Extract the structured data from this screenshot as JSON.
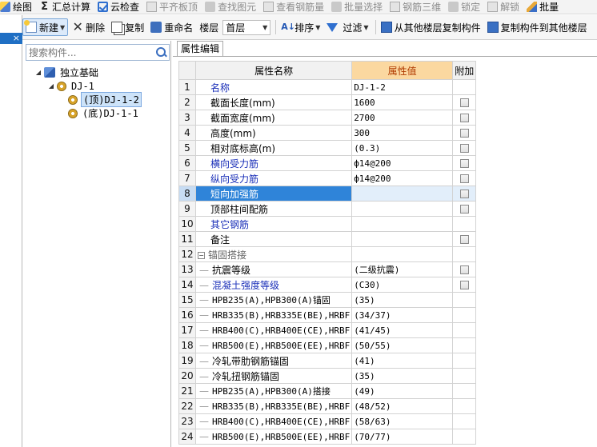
{
  "toolbar1": {
    "items": [
      {
        "label": "绘图",
        "icon": "draw-icon",
        "disabled": false
      },
      {
        "label": "汇总计算",
        "icon": "sum-icon",
        "disabled": false
      },
      {
        "label": "云检查",
        "icon": "cloud-check-icon",
        "disabled": false
      },
      {
        "label": "平齐板顶",
        "icon": "align-top-icon",
        "disabled": true
      },
      {
        "label": "查找图元",
        "icon": "find-element-icon",
        "disabled": true
      },
      {
        "label": "查看钢筋量",
        "icon": "view-rebar-icon",
        "disabled": true
      },
      {
        "label": "批量选择",
        "icon": "batch-select-icon",
        "disabled": true
      },
      {
        "label": "钢筋三维",
        "icon": "rebar-3d-icon",
        "disabled": true
      },
      {
        "label": "锁定",
        "icon": "lock-icon",
        "disabled": true
      },
      {
        "label": "解锁",
        "icon": "unlock-icon",
        "disabled": true
      },
      {
        "label": "批量",
        "icon": "batch-icon",
        "disabled": false
      }
    ]
  },
  "toolbar2": {
    "new_label": "新建",
    "delete_label": "删除",
    "copy_label": "复制",
    "rename_label": "重命名",
    "floor_label": "楼层",
    "floor_value": "首层",
    "sort_label": "排序",
    "filter_label": "过滤",
    "copy_from_label": "从其他楼层复制构件",
    "copy_to_label": "复制构件到其他楼层"
  },
  "left_strip": {
    "tab_close": "×"
  },
  "tree": {
    "search_placeholder": "搜索构件...",
    "root": "独立基础",
    "group": "DJ-1",
    "children": [
      "(顶)DJ-1-2",
      "(底)DJ-1-1"
    ]
  },
  "props": {
    "tab": "属性编辑",
    "headers": {
      "name": "属性名称",
      "value": "属性值",
      "extra": "附加"
    },
    "rows": [
      {
        "n": "1",
        "name": "名称",
        "value": "DJ-1-2",
        "style": "blue",
        "cb": false
      },
      {
        "n": "2",
        "name": "截面长度(mm)",
        "value": "1600",
        "style": "",
        "cb": true
      },
      {
        "n": "3",
        "name": "截面宽度(mm)",
        "value": "2700",
        "style": "",
        "cb": true
      },
      {
        "n": "4",
        "name": "高度(mm)",
        "value": "300",
        "style": "",
        "cb": true
      },
      {
        "n": "5",
        "name": "相对底标高(m)",
        "value": "(0.3)",
        "style": "",
        "cb": true
      },
      {
        "n": "6",
        "name": "横向受力筋",
        "value": "ф14@200",
        "style": "blue",
        "cb": true
      },
      {
        "n": "7",
        "name": "纵向受力筋",
        "value": "ф14@200",
        "style": "blue",
        "cb": true
      },
      {
        "n": "8",
        "name": "短向加强筋",
        "value": "",
        "style": "blue",
        "cb": true,
        "selected": true
      },
      {
        "n": "9",
        "name": "顶部柱间配筋",
        "value": "",
        "style": "",
        "cb": true
      },
      {
        "n": "10",
        "name": "其它钢筋",
        "value": "",
        "style": "blue",
        "cb": false
      },
      {
        "n": "11",
        "name": "备注",
        "value": "",
        "style": "",
        "cb": true
      },
      {
        "n": "12",
        "name": "锚固搭接",
        "value": "",
        "style": "grey",
        "cb": false,
        "group": true
      },
      {
        "n": "13",
        "name": "抗震等级",
        "value": "(二级抗震)",
        "style": "sub",
        "cb": true
      },
      {
        "n": "14",
        "name": "混凝土强度等级",
        "value": "(C30)",
        "style": "sub blue",
        "cb": true
      },
      {
        "n": "15",
        "name": "HPB235(A),HPB300(A)锚固",
        "value": "(35)",
        "style": "sub",
        "cb": false
      },
      {
        "n": "16",
        "name": "HRB335(B),HRB335E(BE),HRBF",
        "value": "(34/37)",
        "style": "sub",
        "cb": false
      },
      {
        "n": "17",
        "name": "HRB400(C),HRB400E(CE),HRBF",
        "value": "(41/45)",
        "style": "sub",
        "cb": false
      },
      {
        "n": "18",
        "name": "HRB500(E),HRB500E(EE),HRBF",
        "value": "(50/55)",
        "style": "sub",
        "cb": false
      },
      {
        "n": "19",
        "name": "冷轧带肋钢筋锚固",
        "value": "(41)",
        "style": "sub",
        "cb": false
      },
      {
        "n": "20",
        "name": "冷轧扭钢筋锚固",
        "value": "(35)",
        "style": "sub",
        "cb": false
      },
      {
        "n": "21",
        "name": "HPB235(A),HPB300(A)搭接",
        "value": "(49)",
        "style": "sub",
        "cb": false
      },
      {
        "n": "22",
        "name": "HRB335(B),HRB335E(BE),HRBF",
        "value": "(48/52)",
        "style": "sub",
        "cb": false
      },
      {
        "n": "23",
        "name": "HRB400(C),HRB400E(CE),HRBF",
        "value": "(58/63)",
        "style": "sub",
        "cb": false
      },
      {
        "n": "24",
        "name": "HRB500(E),HRB500E(EE),HRBF",
        "value": "(70/77)",
        "style": "sub",
        "cb": false
      }
    ]
  }
}
